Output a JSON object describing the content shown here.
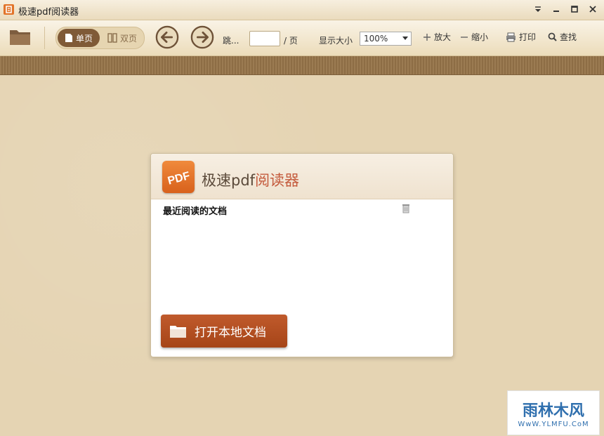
{
  "window": {
    "title": "极速pdf阅读器"
  },
  "toolbar": {
    "single_page": "单页",
    "double_page": "双页",
    "goto_label": "跳...",
    "page_value": "",
    "page_suffix": "/ 页",
    "zoom_label": "显示大小",
    "zoom_value": "100%",
    "zoom_in": "放大",
    "zoom_out": "缩小",
    "print": "打印",
    "find": "查找"
  },
  "card": {
    "title_main": "极速pdf",
    "title_accent": "阅读器",
    "logo_text": "PDF",
    "recent_label": "最近阅读的文档",
    "open_button": "打开本地文档"
  },
  "watermark": {
    "main": "雨林木风",
    "sub": "WwW.YLMFU.CoM"
  },
  "colors": {
    "accent": "#c45a3c",
    "button": "#b04e20",
    "stripe": "#8d6d45"
  }
}
